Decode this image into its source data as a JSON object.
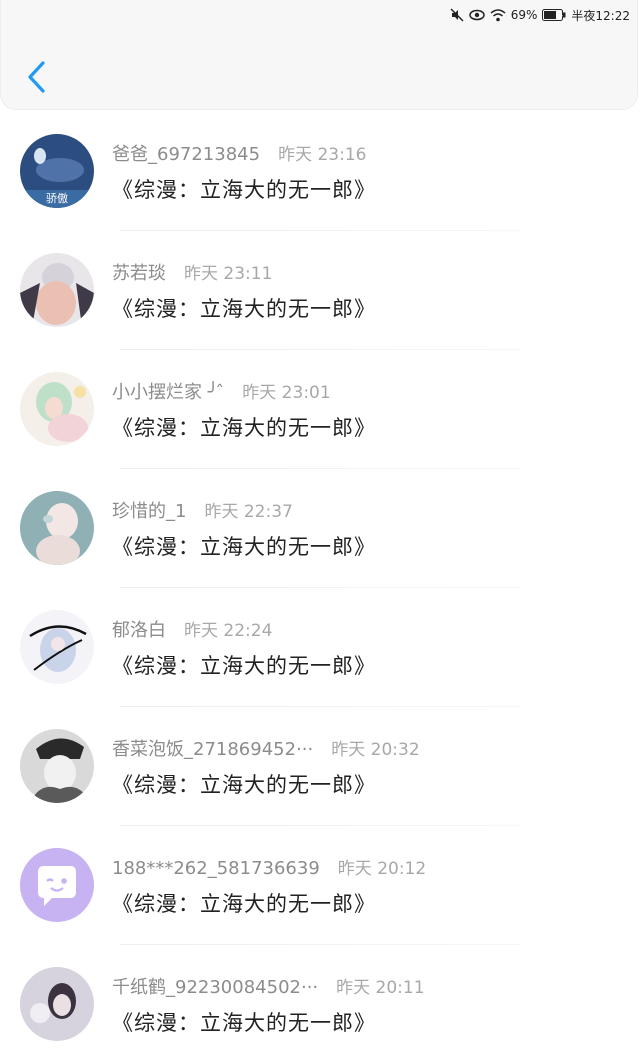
{
  "status_bar": {
    "battery_percent": "69%",
    "time": "半夜12:22",
    "icons": [
      "mute-icon",
      "eye-icon",
      "wifi-icon",
      "battery-icon"
    ]
  },
  "header": {
    "back_icon": "chevron-left-icon",
    "accent_color": "#1e9bf0"
  },
  "messages": [
    {
      "name": "爸爸_697213845",
      "time": "昨天 23:16",
      "title": "《综漫：立海大的无一郎》",
      "avatar_text": "骄傲"
    },
    {
      "name": "苏若琰",
      "time": "昨天 23:11",
      "title": "《综漫：立海大的无一郎》",
      "avatar_text": ""
    },
    {
      "name": "小小摆烂家 ╯ ̂",
      "time": "昨天 23:01",
      "title": "《综漫：立海大的无一郎》",
      "avatar_text": ""
    },
    {
      "name": "珍惜的_1",
      "time": "昨天 22:37",
      "title": "《综漫：立海大的无一郎》",
      "avatar_text": ""
    },
    {
      "name": "郁洛白",
      "time": "昨天 22:24",
      "title": "《综漫：立海大的无一郎》",
      "avatar_text": ""
    },
    {
      "name": "香菜泡饭_271869452···",
      "time": "昨天 20:32",
      "title": "《综漫：立海大的无一郎》",
      "avatar_text": ""
    },
    {
      "name": "188***262_581736639",
      "time": "昨天 20:12",
      "title": "《综漫：立海大的无一郎》",
      "avatar_text": ""
    },
    {
      "name": "千纸鹤_92230084502···",
      "time": "昨天 20:11",
      "title": "《综漫：立海大的无一郎》",
      "avatar_text": ""
    }
  ]
}
